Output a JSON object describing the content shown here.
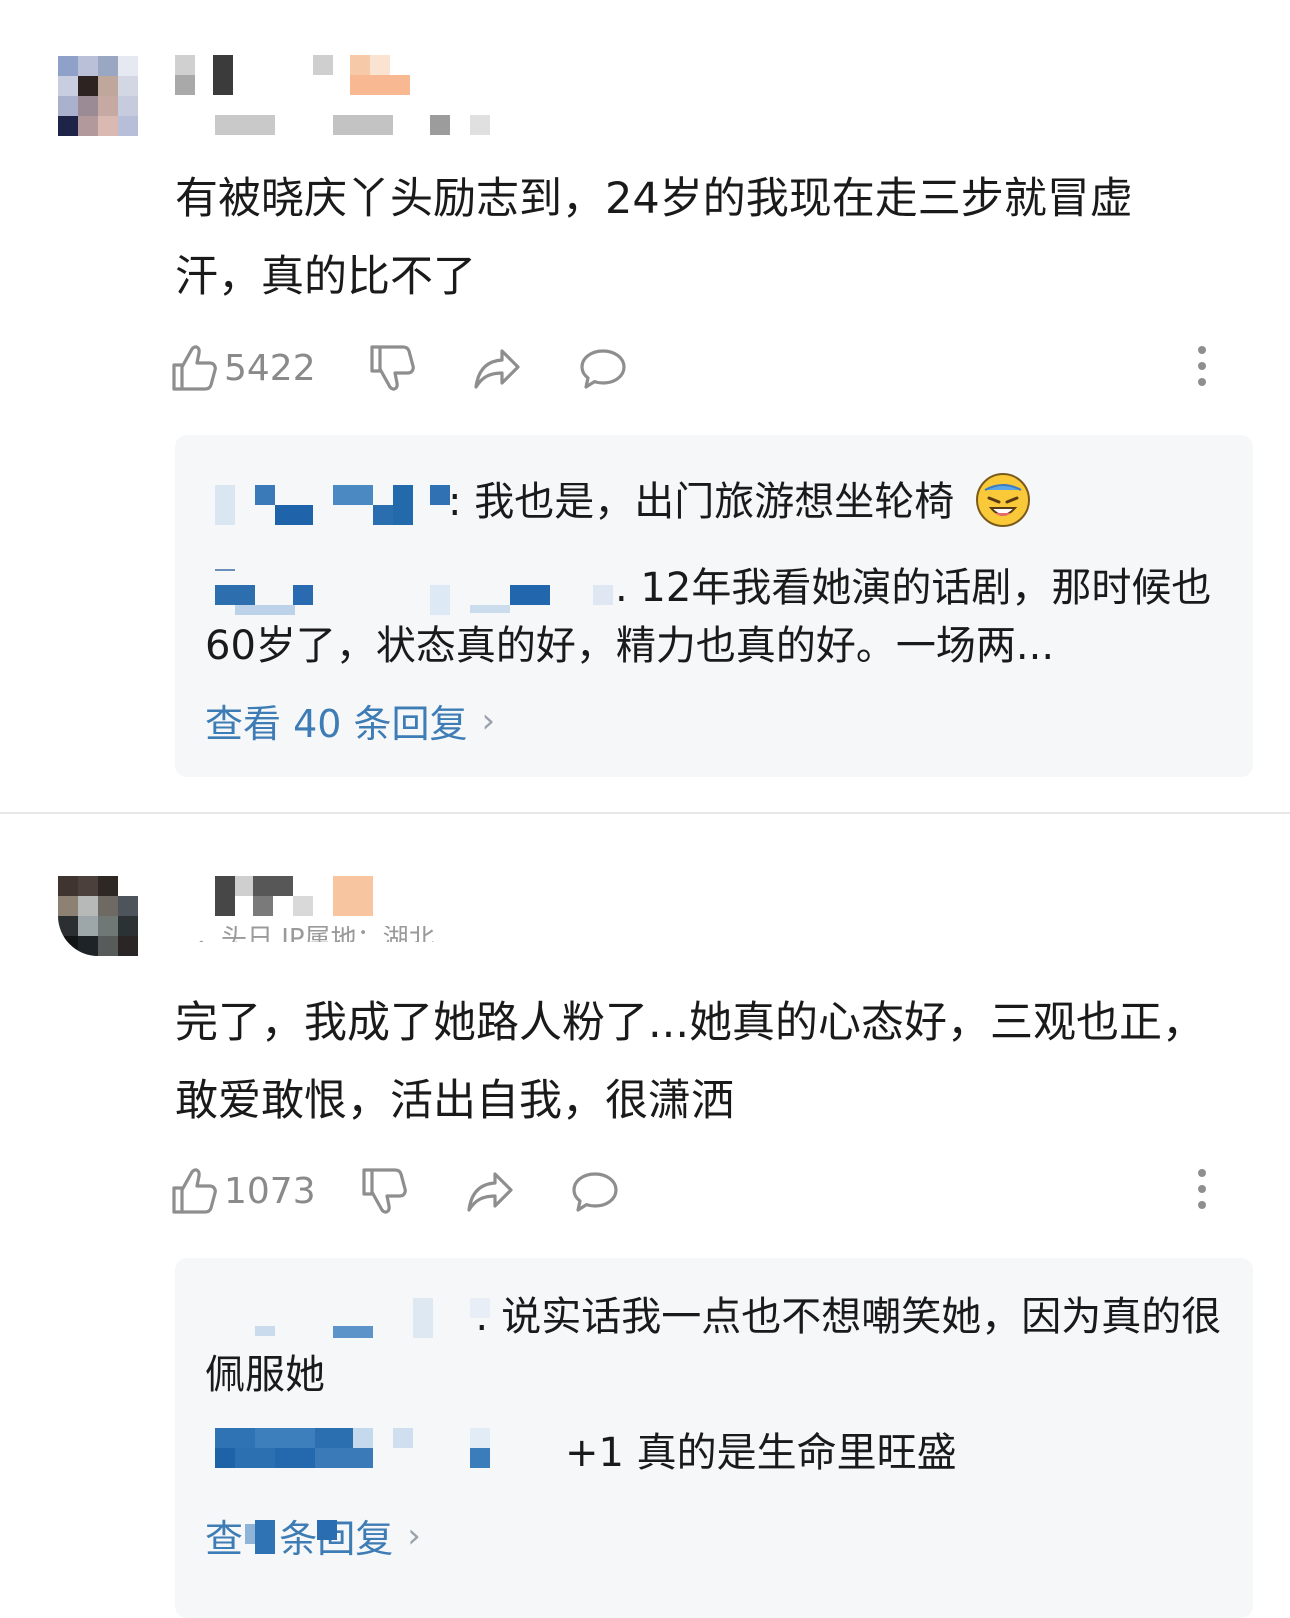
{
  "comments": [
    {
      "body": "有被晓庆丫头励志到，24岁的我现在走三步就冒虚汗，真的比不了",
      "like_count": "5422",
      "replies": [
        {
          "text": ": 我也是，出门旅游想坐轮椅",
          "emoji": "crying-laughing-emoji"
        },
        {
          "text": ". 12年我看她演的话剧，那时候也60岁了，状态真的好，精力也真的好。一场两..."
        }
      ],
      "view_more": "查看 40 条回复"
    },
    {
      "meta_partial": "，头日  IP属地：湖北",
      "body": "完了，我成了她路人粉了...她真的心态好，三观也正，敢爱敢恨，活出自我，很潇洒",
      "like_count": "1073",
      "replies": [
        {
          "text": ": 说实话我一点也不想嘲笑她，因为真的很佩服她"
        },
        {
          "text": "+1 真的是生命里旺盛"
        }
      ],
      "view_more": "查   条回复"
    }
  ],
  "icons": {
    "like": "thumbs-up-icon",
    "dislike": "thumbs-down-icon",
    "share": "share-icon",
    "reply": "comment-bubble-icon",
    "more": "more-vertical-icon"
  },
  "colors": {
    "link": "#3d7cb4",
    "icon": "#8e8e8e",
    "reply_bg": "#f6f7f9",
    "divider": "#e8e8e8"
  }
}
